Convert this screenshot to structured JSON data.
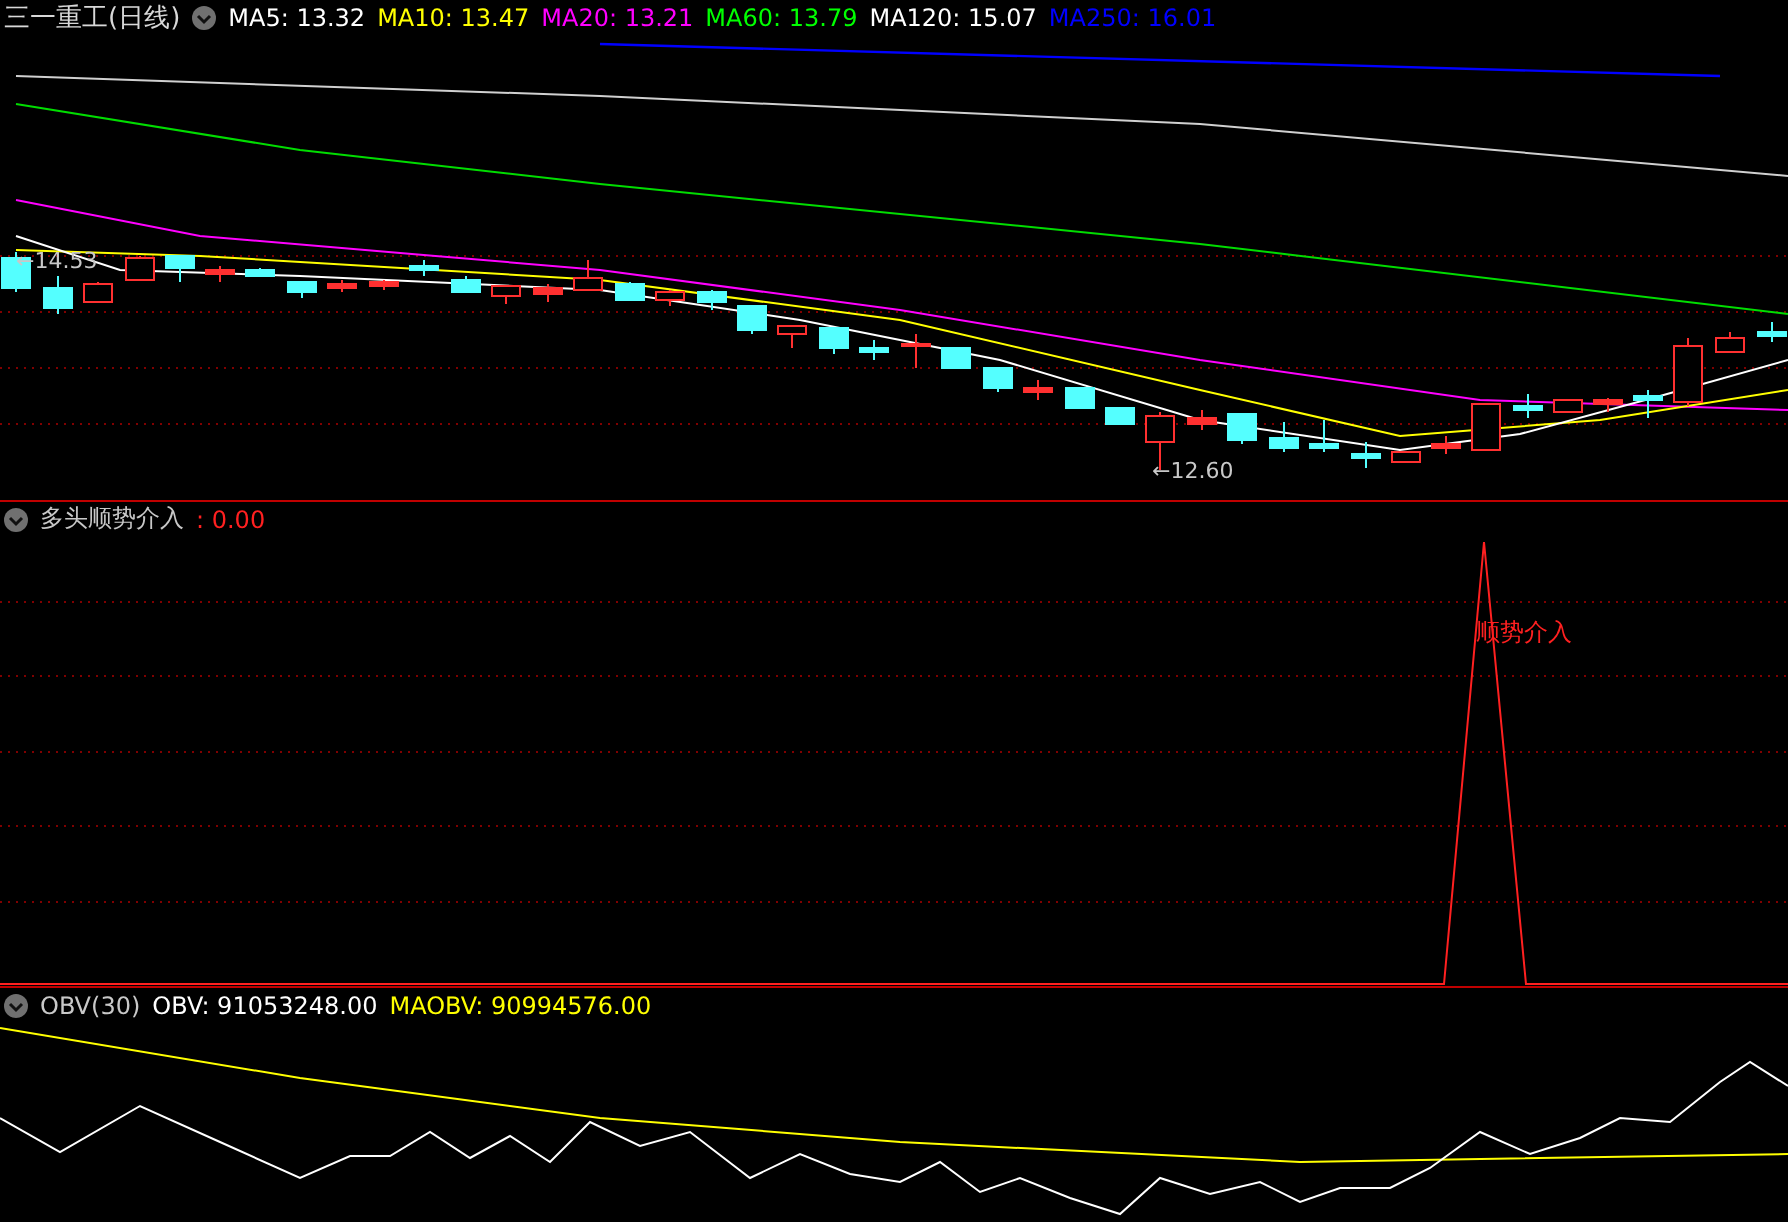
{
  "stock": {
    "title": "三一重工(日线)",
    "indicators": [
      {
        "label": "MA5: 13.32",
        "color": "#ffffff"
      },
      {
        "label": "MA10: 13.47",
        "color": "#ffff00"
      },
      {
        "label": "MA20: 13.21",
        "color": "#ff00ff"
      },
      {
        "label": "MA60: 13.79",
        "color": "#00ff00"
      },
      {
        "label": "MA120: 15.07",
        "color": "#ffffff"
      },
      {
        "label": "MA250: 16.01",
        "color": "#0000ff"
      }
    ]
  },
  "main_chart": {
    "high_label": "←14.53",
    "low_label": "←12.60"
  },
  "signal_panel": {
    "name": "多头顺势介入",
    "value": ": 0.00",
    "signal_label": "顺势介入"
  },
  "obv_panel": {
    "name": "OBV(30)",
    "values": [
      {
        "label": "OBV: 91053248.00",
        "color": "#ffffff"
      },
      {
        "label": "MAOBV: 90994576.00",
        "color": "#ffff00"
      }
    ]
  }
}
